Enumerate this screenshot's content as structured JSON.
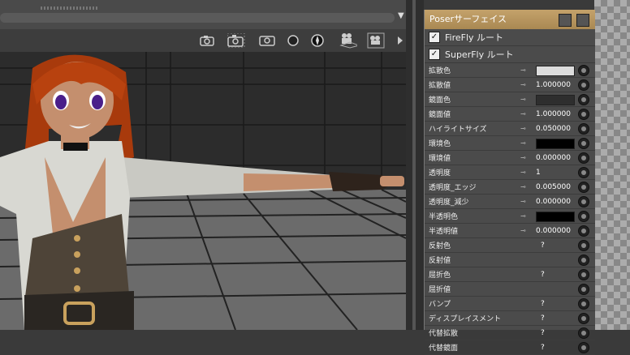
{
  "panel": {
    "title": "Poserサーフェイス",
    "checkboxes": [
      {
        "label": "FireFly ルート",
        "checked": true
      },
      {
        "label": "SuperFly ルート",
        "checked": true
      }
    ],
    "rows": [
      {
        "label": "拡散色",
        "kind": "swatch",
        "color": "#dcdcdc",
        "has_key": true
      },
      {
        "label": "拡散値",
        "kind": "value",
        "value": "1.000000",
        "has_key": true
      },
      {
        "label": "鏡面色",
        "kind": "swatch",
        "color": "#2e2e2e",
        "has_key": true
      },
      {
        "label": "鏡面値",
        "kind": "value",
        "value": "1.000000",
        "has_key": true
      },
      {
        "label": "ハイライトサイズ",
        "kind": "value",
        "value": "0.050000",
        "has_key": true
      },
      {
        "label": "環境色",
        "kind": "swatch",
        "color": "#000000",
        "has_key": true
      },
      {
        "label": "環境値",
        "kind": "value",
        "value": "0.000000",
        "has_key": true
      },
      {
        "label": "透明度",
        "kind": "value",
        "value": "1",
        "has_key": true
      },
      {
        "label": "透明度_エッジ",
        "kind": "value",
        "value": "0.005000",
        "has_key": true
      },
      {
        "label": "透明度_減少",
        "kind": "value",
        "value": "0.000000",
        "has_key": true
      },
      {
        "label": "半透明色",
        "kind": "swatch",
        "color": "#000000",
        "has_key": true
      },
      {
        "label": "半透明値",
        "kind": "value",
        "value": "0.000000",
        "has_key": true
      },
      {
        "label": "反射色",
        "kind": "q",
        "value": "?",
        "has_key": false
      },
      {
        "label": "反射値",
        "kind": "none",
        "has_key": false
      },
      {
        "label": "屈折色",
        "kind": "q",
        "value": "?",
        "has_key": false
      },
      {
        "label": "屈折値",
        "kind": "none",
        "has_key": false
      },
      {
        "label": "バンプ",
        "kind": "q",
        "value": "?",
        "has_key": false
      },
      {
        "label": "ディスプレイスメント",
        "kind": "q",
        "value": "?",
        "has_key": false
      },
      {
        "label": "代替拡散",
        "kind": "q",
        "value": "?",
        "has_key": false
      },
      {
        "label": "代替鏡面",
        "kind": "q",
        "value": "?",
        "has_key": false
      }
    ]
  },
  "icons": {
    "camera": [
      "camera-icon",
      "camera-dotted-icon",
      "camera-flat-icon",
      "sphere-icon",
      "globe-icon",
      "movie-camera-icon",
      "movie-camera-group-icon",
      "play-arrow-icon"
    ],
    "key": "key-icon",
    "knob": "input-knob-icon",
    "checkmark": "✓"
  },
  "colors": {
    "title_bar": "#b8955d"
  }
}
